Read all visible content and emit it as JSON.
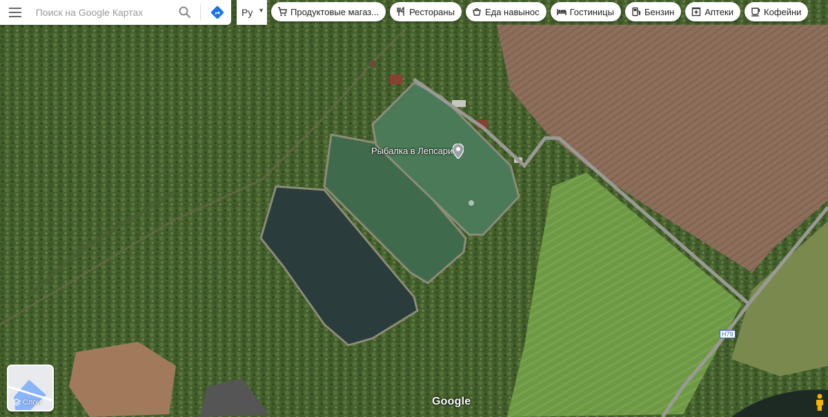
{
  "search": {
    "placeholder": "Поиск на Google Картах"
  },
  "language": {
    "selected": "Ру"
  },
  "chips": [
    {
      "label": "Продуктовые магаз...",
      "icon": "cart-icon"
    },
    {
      "label": "Рестораны",
      "icon": "restaurant-icon"
    },
    {
      "label": "Еда навынос",
      "icon": "takeout-icon"
    },
    {
      "label": "Гостиницы",
      "icon": "hotel-icon"
    },
    {
      "label": "Бензин",
      "icon": "gas-station-icon"
    },
    {
      "label": "Аптеки",
      "icon": "pharmacy-icon"
    },
    {
      "label": "Кофейни",
      "icon": "coffee-icon"
    }
  ],
  "map": {
    "place_label": "Рыбалка в Лепсари",
    "road_label": "H79",
    "logo": "Google",
    "layers_label": "Слои",
    "colors": {
      "forest": "#3f5a2a",
      "field_plowed": "#8a6d5a",
      "field_green": "#6f9a45",
      "water_dark": "#2a3b3a",
      "water_green": "#4c7b58",
      "road": "#8e8e8a"
    }
  }
}
